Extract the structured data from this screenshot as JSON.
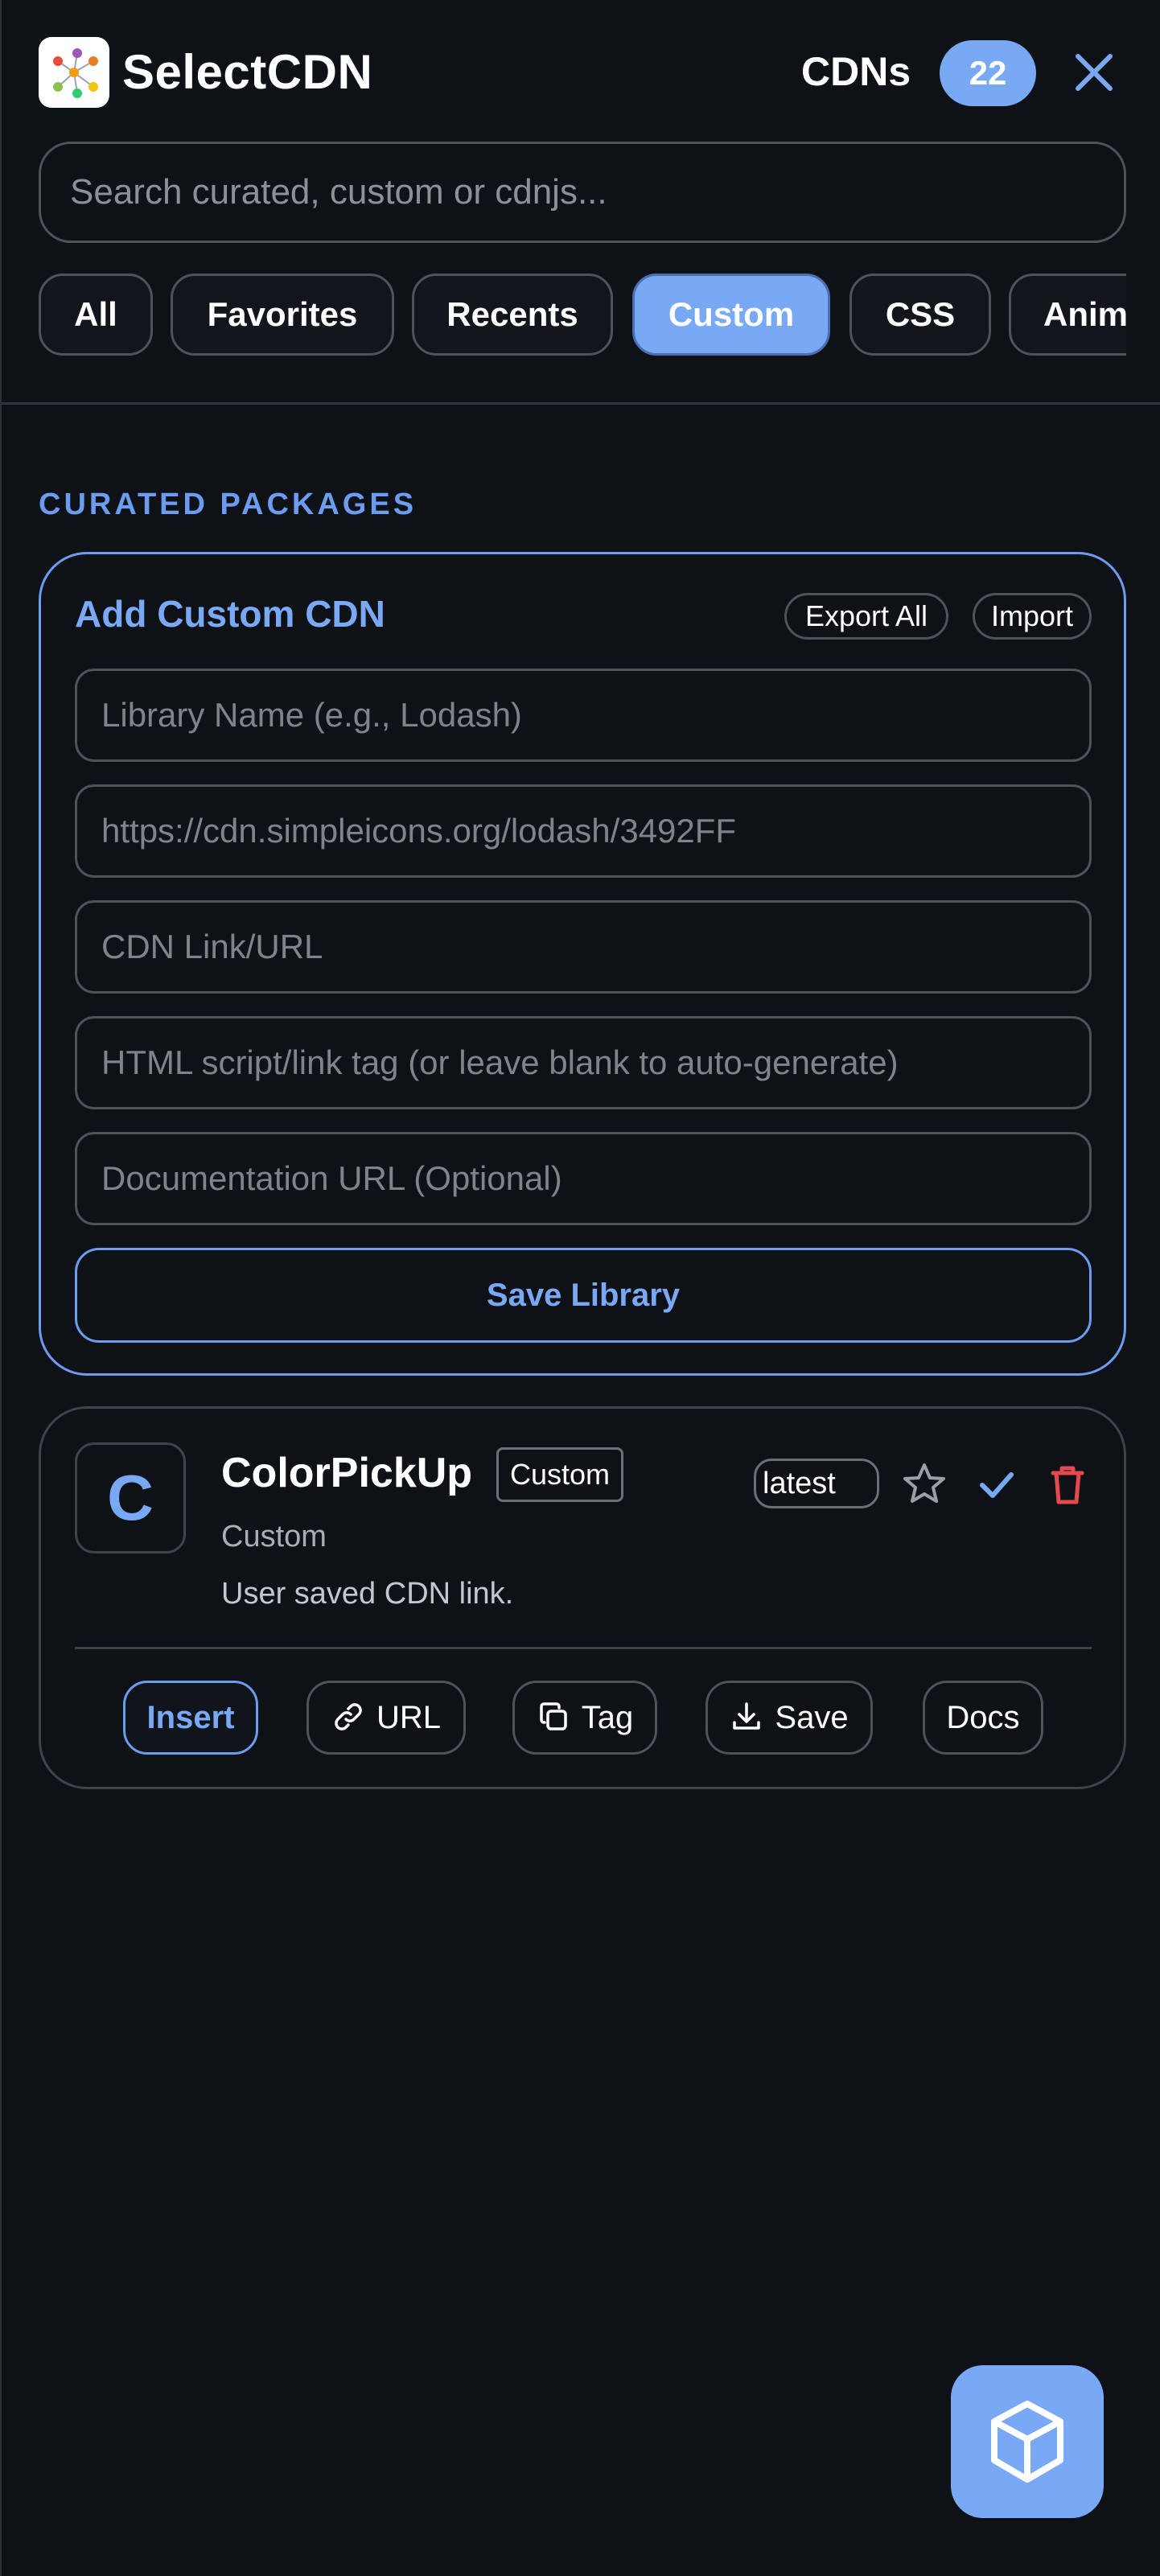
{
  "header": {
    "app_title": "SelectCDN",
    "logo_icon": "network-graph-logo",
    "cdn_label": "CDNs",
    "cdn_count": "22",
    "close_icon": "close-icon"
  },
  "search": {
    "placeholder": "Search curated, custom or cdnjs..."
  },
  "tabs": [
    {
      "label": "All"
    },
    {
      "label": "Favorites"
    },
    {
      "label": "Recents"
    },
    {
      "label": "Custom",
      "active": true
    },
    {
      "label": "CSS"
    },
    {
      "label": "Animation"
    }
  ],
  "section_title": "CURATED PACKAGES",
  "add_custom": {
    "title": "Add Custom CDN",
    "export_label": "Export All",
    "import_label": "Import",
    "fields": {
      "library_name_placeholder": "Library Name (e.g., Lodash)",
      "icon_url_placeholder": "https://cdn.simpleicons.org/lodash/3492FF",
      "cdn_url_placeholder": "CDN Link/URL",
      "html_tag_placeholder": "HTML script/link tag (or leave blank to auto-generate)",
      "docs_url_placeholder": "Documentation URL (Optional)"
    },
    "save_label": "Save Library"
  },
  "library": {
    "avatar_letter": "C",
    "name": "ColorPickUp",
    "badge": "Custom",
    "subtitle": "Custom",
    "description": "User saved CDN link.",
    "version": "latest",
    "actions": {
      "insert": "Insert",
      "url": "URL",
      "tag": "Tag",
      "save": "Save",
      "docs": "Docs"
    }
  },
  "colors": {
    "accent": "#79a8f5",
    "background": "#0e1116",
    "danger": "#e5484d"
  },
  "fab_icon": "cube-icon"
}
